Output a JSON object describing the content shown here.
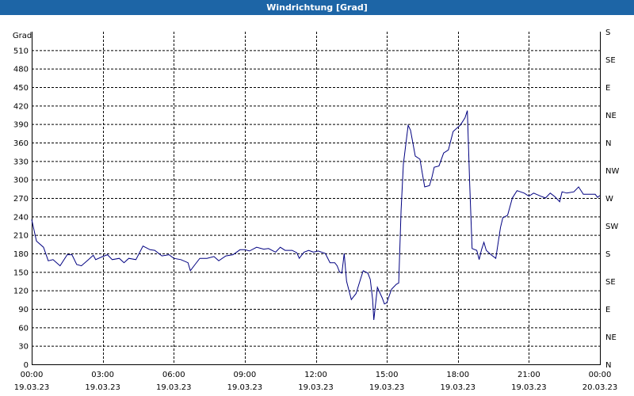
{
  "window": {
    "title": "Windrichtung [Grad]"
  },
  "chart_data": {
    "type": "line",
    "title": "Windrichtung [Grad]",
    "ylabel": "Grad",
    "ylim": [
      0,
      540
    ],
    "yticks": [
      0,
      30,
      60,
      90,
      120,
      150,
      180,
      210,
      240,
      270,
      300,
      330,
      360,
      390,
      420,
      450,
      480,
      510
    ],
    "right_axis": {
      "ticks": [
        {
          "value": 0,
          "label": "N"
        },
        {
          "value": 45,
          "label": "NE"
        },
        {
          "value": 90,
          "label": "E"
        },
        {
          "value": 135,
          "label": "SE"
        },
        {
          "value": 180,
          "label": "S"
        },
        {
          "value": 225,
          "label": "SW"
        },
        {
          "value": 270,
          "label": "W"
        },
        {
          "value": 315,
          "label": "NW"
        },
        {
          "value": 360,
          "label": "N"
        },
        {
          "value": 405,
          "label": "NE"
        },
        {
          "value": 450,
          "label": "E"
        },
        {
          "value": 495,
          "label": "SE"
        },
        {
          "value": 540,
          "label": "S"
        }
      ]
    },
    "xlim": [
      0,
      24
    ],
    "xticks": [
      {
        "hour": 0,
        "time": "00:00",
        "date": "19.03.23"
      },
      {
        "hour": 3,
        "time": "03:00",
        "date": "19.03.23"
      },
      {
        "hour": 6,
        "time": "06:00",
        "date": "19.03.23"
      },
      {
        "hour": 9,
        "time": "09:00",
        "date": "19.03.23"
      },
      {
        "hour": 12,
        "time": "12:00",
        "date": "19.03.23"
      },
      {
        "hour": 15,
        "time": "15:00",
        "date": "19.03.23"
      },
      {
        "hour": 18,
        "time": "18:00",
        "date": "19.03.23"
      },
      {
        "hour": 21,
        "time": "21:00",
        "date": "19.03.23"
      },
      {
        "hour": 24,
        "time": "00:00",
        "date": "20.03.23"
      }
    ],
    "grid": true,
    "line_color": "#000080",
    "series": [
      {
        "values": [
          [
            0.0,
            235
          ],
          [
            0.2,
            200
          ],
          [
            0.5,
            190
          ],
          [
            0.7,
            168
          ],
          [
            0.9,
            170
          ],
          [
            1.2,
            160
          ],
          [
            1.5,
            178
          ],
          [
            1.7,
            178
          ],
          [
            1.9,
            162
          ],
          [
            2.1,
            160
          ],
          [
            2.4,
            170
          ],
          [
            2.6,
            177
          ],
          [
            2.7,
            170
          ],
          [
            3.0,
            175
          ],
          [
            3.2,
            178
          ],
          [
            3.4,
            170
          ],
          [
            3.7,
            172
          ],
          [
            3.9,
            165
          ],
          [
            4.1,
            172
          ],
          [
            4.4,
            170
          ],
          [
            4.7,
            192
          ],
          [
            5.0,
            186
          ],
          [
            5.2,
            185
          ],
          [
            5.5,
            176
          ],
          [
            5.8,
            178
          ],
          [
            6.0,
            172
          ],
          [
            6.3,
            170
          ],
          [
            6.6,
            165
          ],
          [
            6.7,
            152
          ],
          [
            6.9,
            162
          ],
          [
            7.1,
            172
          ],
          [
            7.4,
            172
          ],
          [
            7.7,
            175
          ],
          [
            7.9,
            168
          ],
          [
            8.2,
            176
          ],
          [
            8.5,
            178
          ],
          [
            8.8,
            186
          ],
          [
            9.0,
            186
          ],
          [
            9.2,
            184
          ],
          [
            9.5,
            190
          ],
          [
            9.8,
            187
          ],
          [
            10.0,
            188
          ],
          [
            10.3,
            182
          ],
          [
            10.5,
            190
          ],
          [
            10.7,
            185
          ],
          [
            11.0,
            185
          ],
          [
            11.2,
            181
          ],
          [
            11.3,
            172
          ],
          [
            11.5,
            182
          ],
          [
            11.7,
            185
          ],
          [
            11.9,
            182
          ],
          [
            12.1,
            184
          ],
          [
            12.4,
            180
          ],
          [
            12.6,
            165
          ],
          [
            12.8,
            165
          ],
          [
            12.9,
            160
          ],
          [
            13.0,
            150
          ],
          [
            13.1,
            148
          ],
          [
            13.2,
            180
          ],
          [
            13.3,
            135
          ],
          [
            13.5,
            105
          ],
          [
            13.7,
            115
          ],
          [
            13.9,
            140
          ],
          [
            14.0,
            152
          ],
          [
            14.2,
            148
          ],
          [
            14.3,
            138
          ],
          [
            14.4,
            105
          ],
          [
            14.45,
            72
          ],
          [
            14.6,
            125
          ],
          [
            14.8,
            108
          ],
          [
            14.9,
            98
          ],
          [
            15.0,
            100
          ],
          [
            15.2,
            122
          ],
          [
            15.4,
            130
          ],
          [
            15.5,
            132
          ],
          [
            15.6,
            250
          ],
          [
            15.7,
            325
          ],
          [
            15.9,
            388
          ],
          [
            16.0,
            380
          ],
          [
            16.2,
            338
          ],
          [
            16.4,
            333
          ],
          [
            16.5,
            310
          ],
          [
            16.6,
            288
          ],
          [
            16.8,
            290
          ],
          [
            16.9,
            303
          ],
          [
            17.0,
            320
          ],
          [
            17.2,
            322
          ],
          [
            17.4,
            343
          ],
          [
            17.6,
            348
          ],
          [
            17.8,
            378
          ],
          [
            18.0,
            385
          ],
          [
            18.1,
            388
          ],
          [
            18.3,
            400
          ],
          [
            18.4,
            412
          ],
          [
            18.5,
            292
          ],
          [
            18.6,
            188
          ],
          [
            18.8,
            185
          ],
          [
            18.9,
            170
          ],
          [
            19.0,
            186
          ],
          [
            19.1,
            198
          ],
          [
            19.2,
            185
          ],
          [
            19.4,
            178
          ],
          [
            19.6,
            172
          ],
          [
            19.8,
            222
          ],
          [
            19.9,
            238
          ],
          [
            20.1,
            242
          ],
          [
            20.3,
            270
          ],
          [
            20.5,
            282
          ],
          [
            20.8,
            278
          ],
          [
            21.0,
            273
          ],
          [
            21.2,
            278
          ],
          [
            21.5,
            273
          ],
          [
            21.7,
            270
          ],
          [
            21.9,
            278
          ],
          [
            22.1,
            272
          ],
          [
            22.3,
            264
          ],
          [
            22.4,
            280
          ],
          [
            22.6,
            278
          ],
          [
            22.9,
            280
          ],
          [
            23.1,
            288
          ],
          [
            23.3,
            276
          ],
          [
            23.6,
            276
          ],
          [
            23.8,
            276
          ],
          [
            23.9,
            271
          ],
          [
            24.0,
            274
          ]
        ]
      }
    ]
  }
}
